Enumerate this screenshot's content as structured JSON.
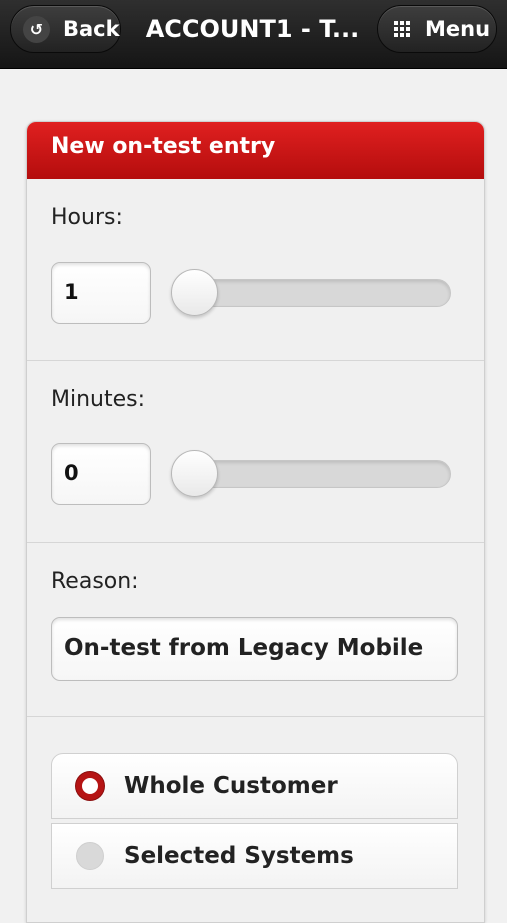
{
  "header": {
    "back_label": "Back",
    "title": "ACCOUNT1 - T...",
    "menu_label": "Menu",
    "back_icon": "undo-arrow-icon",
    "menu_icon": "grid-icon"
  },
  "panel": {
    "title": "New on-test entry",
    "accent_color": "#cc1a1a"
  },
  "hours": {
    "label": "Hours:",
    "value": "1",
    "slider_fraction": 0.0
  },
  "minutes": {
    "label": "Minutes:",
    "value": "0",
    "slider_fraction": 0.0
  },
  "reason": {
    "label": "Reason:",
    "value": "On-test from Legacy Mobile"
  },
  "scope": {
    "options": [
      {
        "label": "Whole Customer",
        "selected": true
      },
      {
        "label": "Selected Systems",
        "selected": false
      }
    ]
  }
}
